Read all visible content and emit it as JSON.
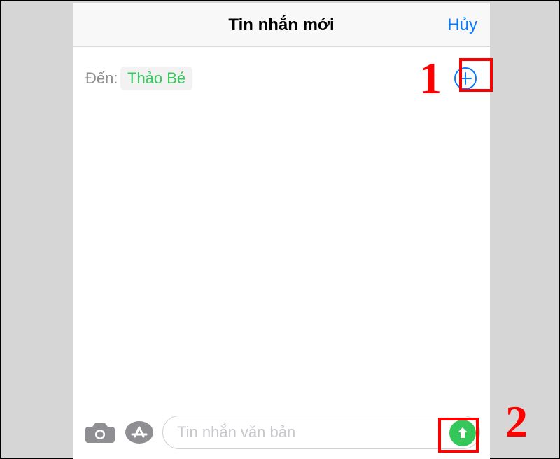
{
  "header": {
    "title": "Tin nhắn mới",
    "cancel": "Hủy"
  },
  "recipient": {
    "label": "Đến:",
    "name": "Thảo Bé"
  },
  "compose": {
    "placeholder": "Tin nhắn văn bản"
  },
  "annotations": {
    "one": "1",
    "two": "2"
  },
  "icons": {
    "add": "plus-circle",
    "camera": "camera",
    "apps": "app-store",
    "send": "arrow-up"
  },
  "colors": {
    "accent_blue": "#0a7aff",
    "accent_green": "#34c759",
    "annotation_red": "#ff0000"
  }
}
